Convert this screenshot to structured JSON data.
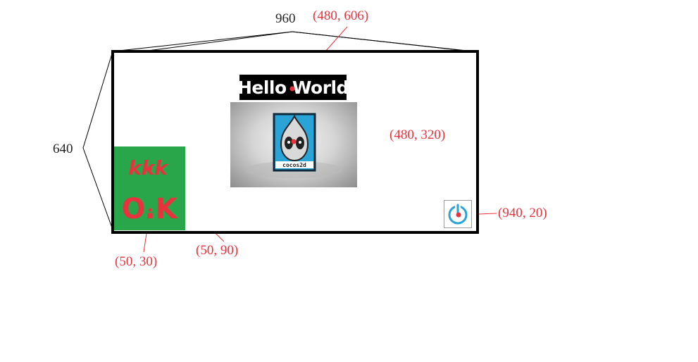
{
  "dimensions": {
    "width_label": "960",
    "height_label": "640"
  },
  "annotations": {
    "hello_world_position": "(480, 606)",
    "logo_position": "(480, 320)",
    "power_button_position": "(940, 20)",
    "ok_position": "(50, 30)",
    "kkk_position": "(50, 90)"
  },
  "screen": {
    "hello_banner_text": "Hello World",
    "green_box_text_top": "kkk",
    "green_box_text_bottom": "O.K",
    "logo_caption": "cocos2d"
  },
  "colors": {
    "annotation_red": "#e8323c",
    "green_box": "#29a64a",
    "logo_blue": "#2aa3d6",
    "handwriting_red": "#e8323c"
  },
  "icons": {
    "power_button": "power-icon",
    "logo": "cocos2d-logo-icon"
  }
}
